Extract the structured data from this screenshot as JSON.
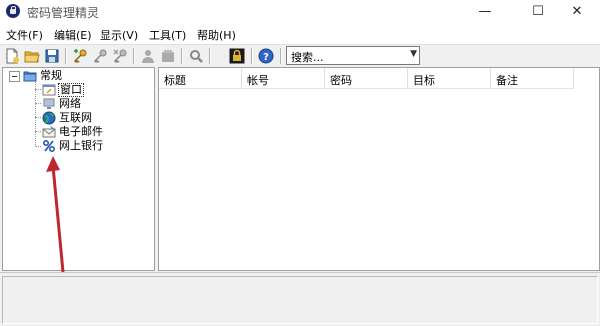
{
  "window": {
    "title": "密码管理精灵",
    "minimize": "—",
    "maximize": "☐",
    "close": "✕"
  },
  "menu": [
    "文件(F)",
    "编辑(E)",
    "显示(V)",
    "工具(T)",
    "帮助(H)"
  ],
  "toolbar": {
    "search_placeholder": "搜索...",
    "buttons": [
      "new-file",
      "open-folder",
      "save",
      "add-key",
      "edit-key",
      "delete-key",
      "user",
      "group",
      "find",
      "lock",
      "help"
    ]
  },
  "tree": {
    "root": "常规",
    "children": [
      "窗口",
      "网络",
      "互联网",
      "电子邮件",
      "网上银行"
    ]
  },
  "columns": [
    "标题",
    "帐号",
    "密码",
    "目标",
    "备注"
  ],
  "colors": {
    "accent_arrow": "#c0262d",
    "selected_bg": "#ffffff"
  }
}
